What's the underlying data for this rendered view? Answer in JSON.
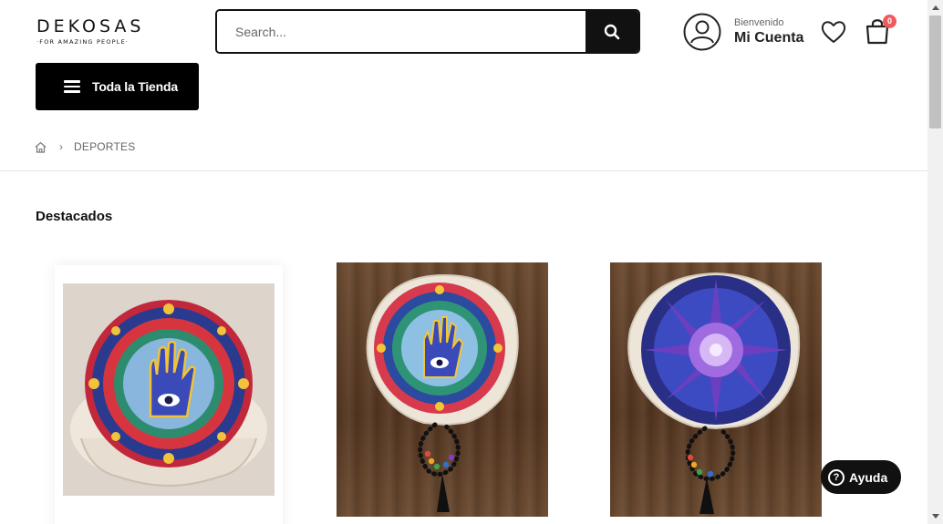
{
  "brand": {
    "name": "DEKOSAS",
    "tagline": "·FOR AMAZING PEOPLE·"
  },
  "search": {
    "placeholder": "Search...",
    "value": ""
  },
  "account": {
    "greeting": "Bienvenido",
    "label": "Mi Cuenta"
  },
  "cart": {
    "count": "0"
  },
  "nav": {
    "store_label": "Toda la Tienda"
  },
  "breadcrumb": {
    "items": [
      "DEPORTES"
    ]
  },
  "section": {
    "title": "Destacados"
  },
  "products": [
    {
      "image": "meditation-cushion-hamsa-mandala"
    },
    {
      "image": "meditation-cushion-hamsa-mala-beads"
    },
    {
      "image": "meditation-cushion-blue-mandala-mala-beads"
    }
  ],
  "help": {
    "label": "Ayuda"
  },
  "icons": [
    "search-icon",
    "user-icon",
    "heart-icon",
    "shopping-bag-icon",
    "menu-icon",
    "home-icon",
    "chevron-right-icon",
    "help-icon"
  ],
  "colors": {
    "primary": "#111111",
    "badge": "#f05a5a"
  }
}
